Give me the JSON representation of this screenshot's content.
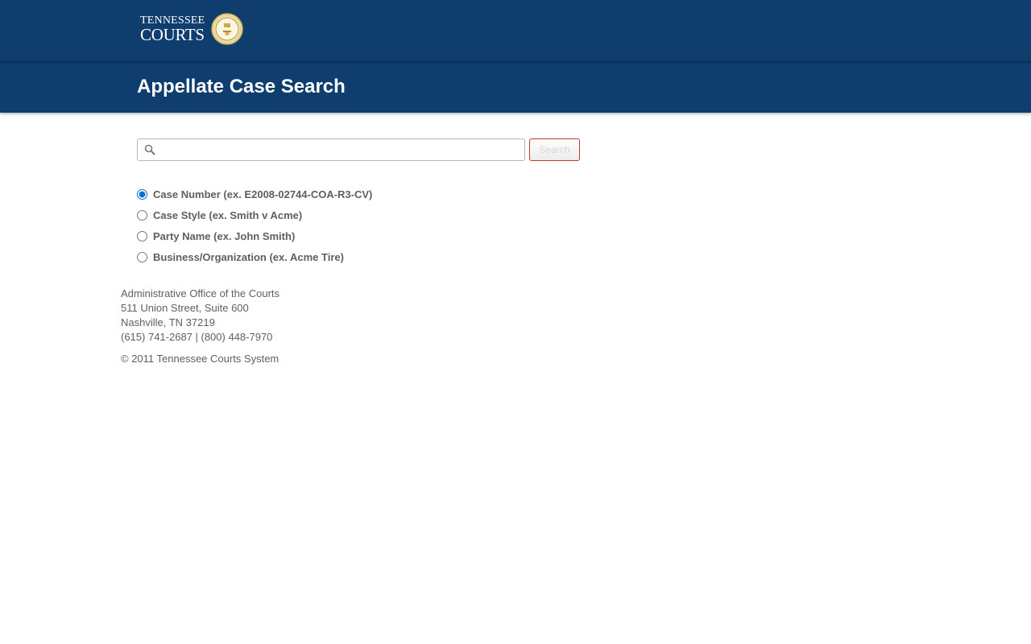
{
  "header": {
    "logo_line1": "TENNESSEE",
    "logo_line2": "COURTS",
    "seal_icon": "state-seal-icon"
  },
  "page": {
    "title": "Appellate Case Search"
  },
  "search": {
    "value": "",
    "placeholder": "",
    "button_label": "Search",
    "icon": "search-icon"
  },
  "options": [
    {
      "label": "Case Number (ex. E2008-02744-COA-R3-CV)",
      "selected": true
    },
    {
      "label": "Case Style (ex. Smith v Acme)",
      "selected": false
    },
    {
      "label": "Party Name (ex. John Smith)",
      "selected": false
    },
    {
      "label": "Business/Organization (ex. Acme Tire)",
      "selected": false
    }
  ],
  "footer": {
    "org": "Administrative Office of the Courts",
    "street": "511 Union Street, Suite 600",
    "city": "Nashville, TN 37219",
    "phones": "(615) 741-2687 | (800) 448-7970",
    "copyright": "© 2011 Tennessee Courts System"
  },
  "colors": {
    "header_bg": "#0e3d6e",
    "accent_radio": "#0a6fd6",
    "button_border": "#c0392b",
    "text_gray": "#5f5f5f"
  }
}
